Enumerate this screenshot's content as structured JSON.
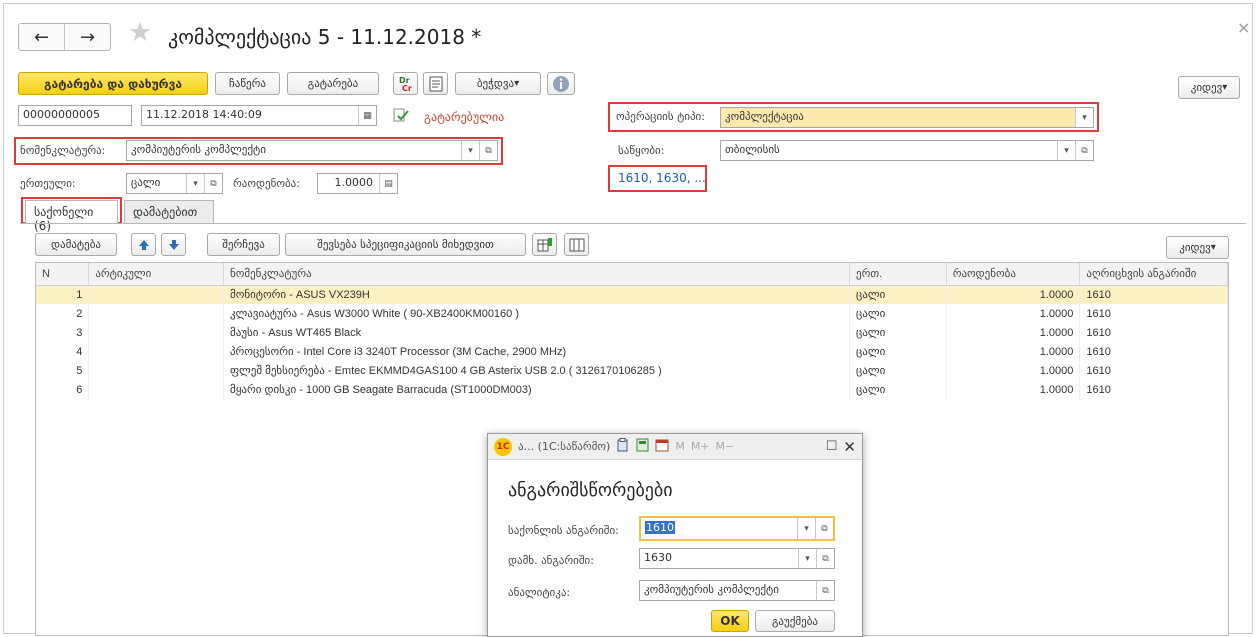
{
  "window": {
    "title": "კომპლექტაცია 5 - 11.12.2018 *",
    "back_icon": "←",
    "forward_icon": "→",
    "star_icon": "★",
    "close_icon": "×"
  },
  "toolbar": {
    "post_close_label": "გატარება და დახურვა",
    "save_label": "ჩაწერა",
    "post_label": "გატარება",
    "dtcr_label_top": "Dr",
    "dtcr_label_bottom": "Cr",
    "print_label": "ბეჭდვა",
    "more_label": "კიდევ"
  },
  "header": {
    "number": "00000000005",
    "datetime": "11.12.2018 14:40:09",
    "posted_status": "გატარებულია",
    "operation_type_label": "ოპერაციის ტიპი:",
    "operation_type_value": "კომპლექტაცია",
    "nomenclature_label": "ნომენკლატურა:",
    "nomenclature_value": "კომპიუტერის კომპლექტი",
    "warehouse_label": "საწყობი:",
    "warehouse_value": "თბილისის",
    "unit_label": "ერთეული:",
    "unit_value": "ცალი",
    "quantity_label": "რაოდენობა:",
    "quantity_value": "1.0000",
    "accounts_link": "1610, 1630, ..."
  },
  "tabs": [
    {
      "label": "საქონელი (6)"
    },
    {
      "label": "დამატებით"
    }
  ],
  "table_toolbar": {
    "add_label": "დამატება",
    "select_label": "შერჩევა",
    "fill_spec_label": "შევსება სპეციფიკაციის მიხედვით",
    "more_label": "კიდევ"
  },
  "table": {
    "columns": [
      "N",
      "არტიკული",
      "ნომენკლატურა",
      "ერთ.",
      "რაოდენობა",
      "აღრიცხვის ანგარიში"
    ],
    "rows": [
      {
        "n": "1",
        "article": "",
        "name": "მონიტორი - ASUS VX239H",
        "unit": "ცალი",
        "qty": "1.0000",
        "account": "1610"
      },
      {
        "n": "2",
        "article": "",
        "name": "კლავიატურა - Asus W3000 White ( 90-XB2400KM00160 )",
        "unit": "ცალი",
        "qty": "1.0000",
        "account": "1610"
      },
      {
        "n": "3",
        "article": "",
        "name": "მაუსი - Asus WT465 Black",
        "unit": "ცალი",
        "qty": "1.0000",
        "account": "1610"
      },
      {
        "n": "4",
        "article": "",
        "name": "პროცესორი - Intel Core i3 3240T Processor (3M Cache, 2900 MHz)",
        "unit": "ცალი",
        "qty": "1.0000",
        "account": "1610"
      },
      {
        "n": "5",
        "article": "",
        "name": "ფლეშ მეხსიერება - Emtec EKMMD4GAS100 4 GB Asterix USB 2.0 ( 3126170106285 )",
        "unit": "ცალი",
        "qty": "1.0000",
        "account": "1610"
      },
      {
        "n": "6",
        "article": "",
        "name": "მყარი დისკი - 1000 GB Seagate Barracuda (ST1000DM003)",
        "unit": "ცალი",
        "qty": "1.0000",
        "account": "1610"
      }
    ]
  },
  "dialog": {
    "window_caption": "ა... (1C:საწარმო)",
    "title": "ანგარიშსწორებები",
    "goods_account_label": "საქონლის ანგარიში:",
    "goods_account_value": "1610",
    "addl_account_label": "დამხ. ანგარიში:",
    "addl_account_value": "1630",
    "analytics_label": "ანალიტიკა:",
    "analytics_value": "კომპიუტერის კომპლექტი",
    "ok_label": "OK",
    "cancel_label": "გაუქმება",
    "m_label": "M",
    "mplus_label": "M+",
    "mminus_label": "M−",
    "logo_text": "1C"
  },
  "colors": {
    "accent_yellow": "#f4cf12",
    "highlight_red": "#dc3b3b",
    "selected_row": "#fdf0c2",
    "link_blue": "#1a5fb4"
  }
}
